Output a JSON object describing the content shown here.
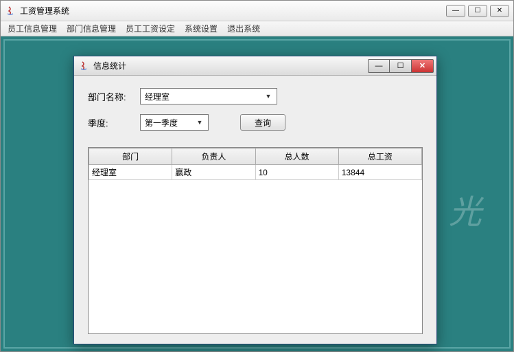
{
  "main": {
    "title": "工资管理系统",
    "menu": [
      "员工信息管理",
      "部门信息管理",
      "员工工资设定",
      "系统设置",
      "退出系统"
    ]
  },
  "dialog": {
    "title": "信息统计",
    "form": {
      "dept_label": "部门名称:",
      "dept_value": "经理室",
      "quarter_label": "季度:",
      "quarter_value": "第一季度",
      "query_btn": "查询"
    },
    "table": {
      "headers": [
        "部门",
        "负责人",
        "总人数",
        "总工资"
      ],
      "rows": [
        {
          "dept": "经理室",
          "leader": "嬴政",
          "count": "10",
          "salary": "13844"
        }
      ]
    }
  },
  "win_controls": {
    "min": "—",
    "max": "☐",
    "close": "✕"
  }
}
